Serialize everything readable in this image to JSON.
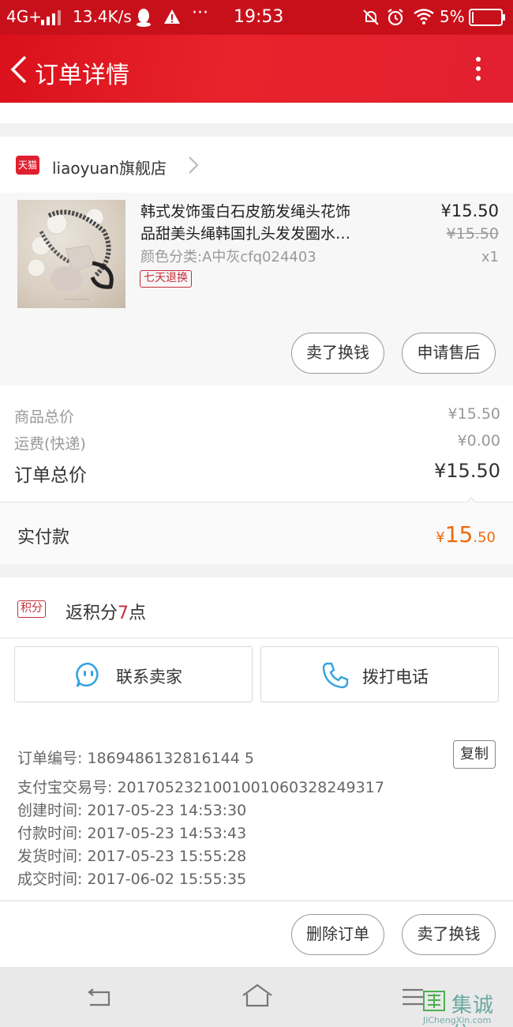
{
  "status_bar": {
    "network": "4G+",
    "speed": "13.4K/s",
    "time": "19:53",
    "battery": "5%"
  },
  "header": {
    "title": "订单详情"
  },
  "store": {
    "badge": "天猫",
    "name": "liaoyuan旗舰店"
  },
  "product": {
    "name_line1": "韩式发饰蛋白石皮筋发绳头花饰",
    "name_line2": "品甜美头绳韩国扎头发发圈水…",
    "variant": "颜色分类:A中灰cfq024403",
    "tag": "七天退换",
    "price": "¥15.50",
    "original_price": "¥15.50",
    "quantity": "x1",
    "sell_button": "卖了换钱",
    "aftersale_button": "申请售后"
  },
  "totals": {
    "goods_label": "商品总价",
    "goods_value": "¥15.50",
    "shipping_label": "运费(快递)",
    "shipping_value": "¥0.00",
    "order_total_label": "订单总价",
    "order_total_value": "¥15.50",
    "paid_label": "实付款",
    "paid_currency": "¥",
    "paid_int": "15",
    "paid_dec": ".50"
  },
  "points": {
    "badge": "积分",
    "text_prefix": "返积分",
    "count": "7",
    "text_suffix": "点"
  },
  "actions": {
    "contact_seller": "联系卖家",
    "call_phone": "拨打电话"
  },
  "order_info": {
    "order_no": "订单编号: 1869486132816144 5",
    "alipay_no": "支付宝交易号: 2017052321001001060328249317",
    "created": "创建时间: 2017-05-23 14:53:30",
    "paid": "付款时间: 2017-05-23 14:53:43",
    "shipped": "发货时间: 2017-05-23 15:55:28",
    "completed": "成交时间: 2017-06-02 15:55:35",
    "copy_button": "复制"
  },
  "bottom_actions": {
    "delete_order": "删除订单",
    "sell_for_cash": "卖了换钱"
  },
  "watermark": {
    "brand": "集诚信",
    "site": "JiChengXin.com"
  },
  "colors": {
    "brand_red": "#e02030",
    "price_orange": "#ee6a0e",
    "tag_red": "#c62e38",
    "icon_blue": "#36a3e0"
  }
}
